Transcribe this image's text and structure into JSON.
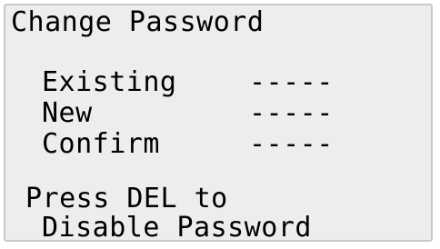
{
  "screen": {
    "title": "Change Password",
    "fields": [
      {
        "label": "Existing",
        "value": "-----"
      },
      {
        "label": "New",
        "value": "-----"
      },
      {
        "label": "Confirm",
        "value": "-----"
      }
    ],
    "hint_line_1": "Press DEL to",
    "hint_line_2": "Disable Password"
  }
}
